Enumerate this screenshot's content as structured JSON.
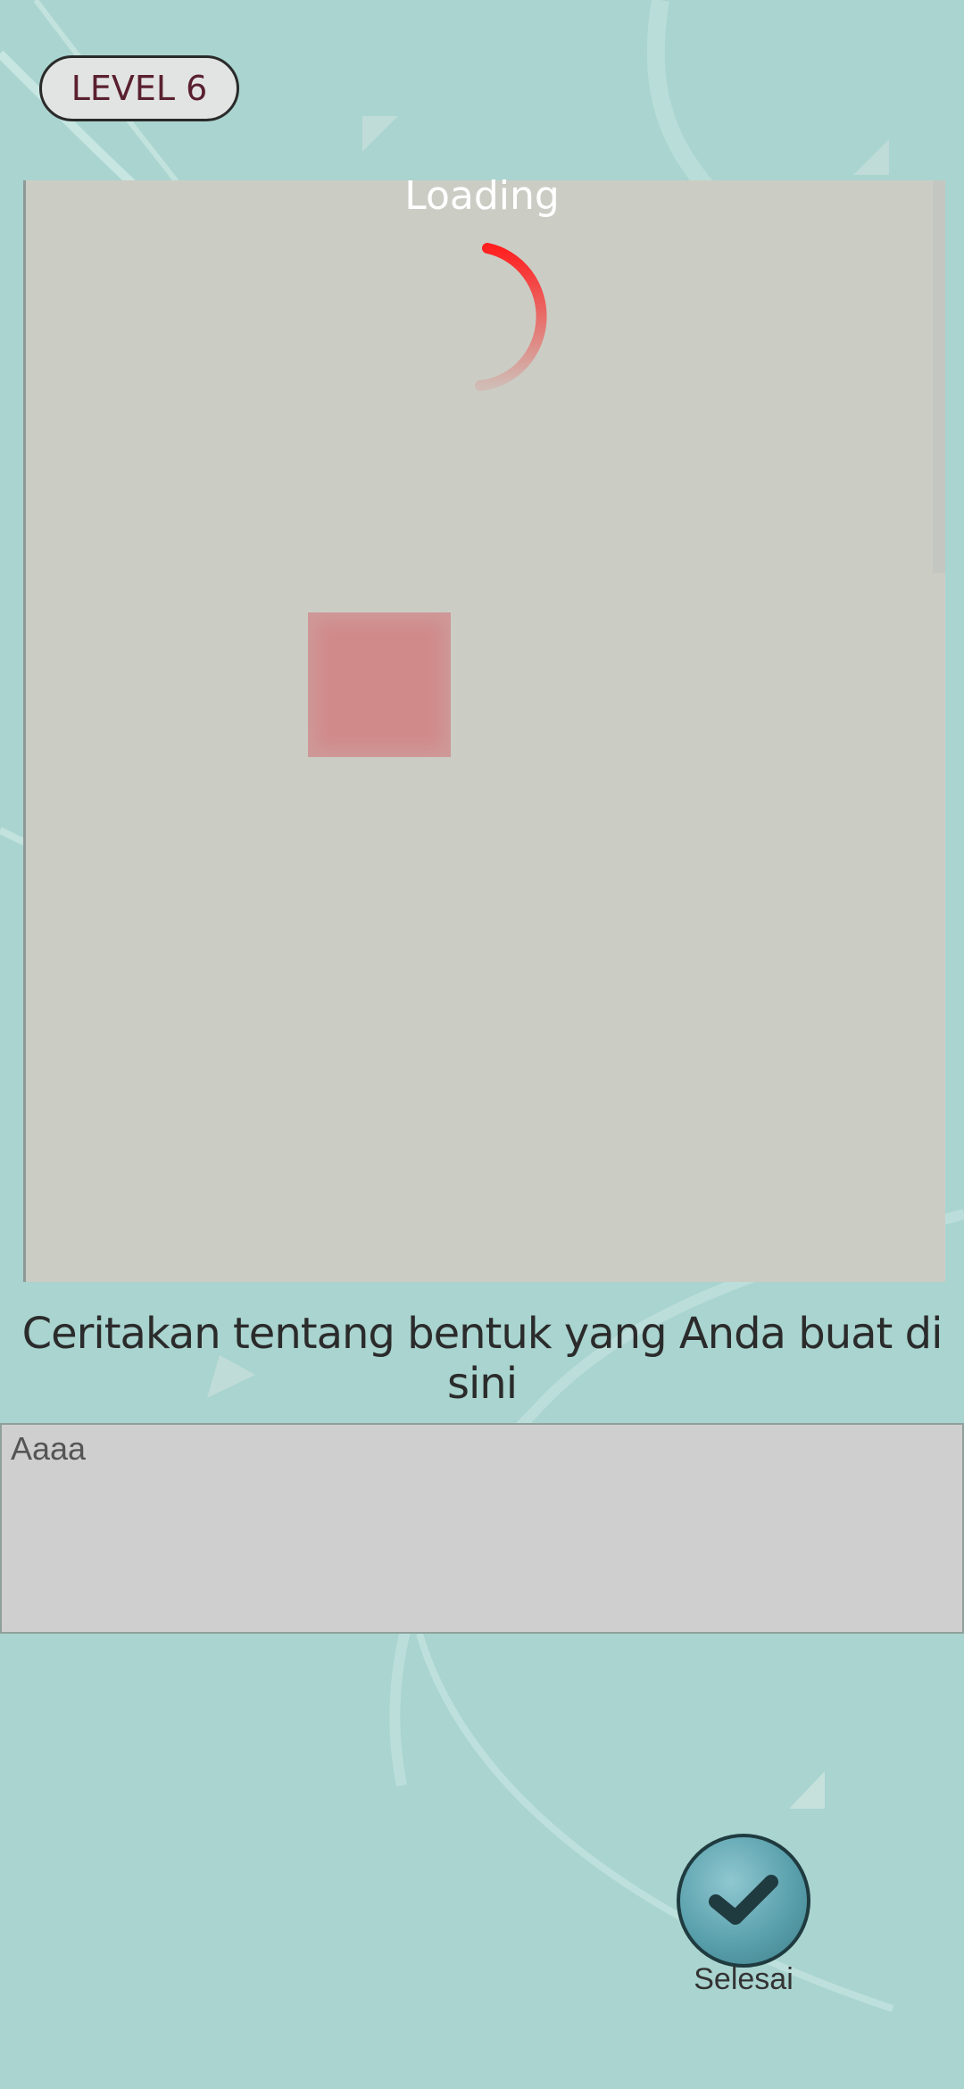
{
  "header": {
    "level_label": "LEVEL 6"
  },
  "canvas": {
    "loading_text": "Loading"
  },
  "prompt": {
    "text": "Ceritakan tentang bentuk yang Anda buat di sini"
  },
  "answer": {
    "value": "Aaaa"
  },
  "actions": {
    "done_label": "Selesai",
    "done_icon": "checkmark-icon"
  },
  "colors": {
    "background": "#a9d4cf",
    "canvas": "#cbcdc5",
    "spinner": "#ff1f1f",
    "shape": "#d08a8a",
    "button": "#5aa1ad"
  }
}
